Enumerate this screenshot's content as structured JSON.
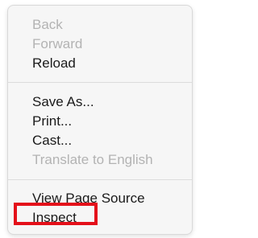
{
  "menu": {
    "back": "Back",
    "forward": "Forward",
    "reload": "Reload",
    "save_as": "Save As...",
    "print": "Print...",
    "cast": "Cast...",
    "translate": "Translate to English",
    "view_source": "View Page Source",
    "inspect": "Inspect"
  },
  "highlight_color": "#e4101a"
}
